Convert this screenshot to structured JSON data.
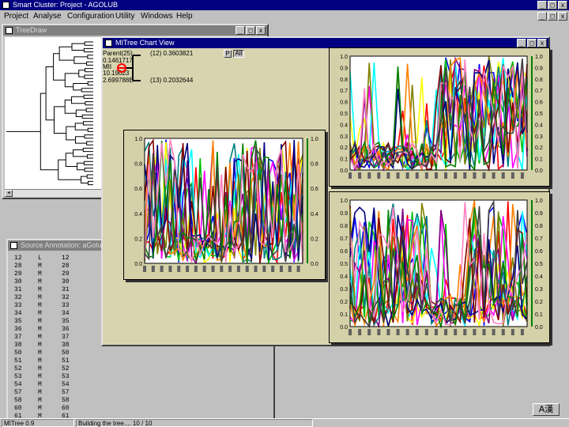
{
  "app": {
    "title": "Smart Cluster: Project - AGOLUB",
    "menu": [
      "Project",
      "Analyse",
      "Configuration",
      "Utility",
      "Windows",
      "Help"
    ],
    "window_buttons": [
      "_",
      "□",
      "x"
    ]
  },
  "treedraw": {
    "title": "TreeDraw"
  },
  "annotation": {
    "title": "Source Annotation: aGolub",
    "rows": [
      [
        "12",
        "L",
        "12"
      ],
      [
        "28",
        "M",
        "28"
      ],
      [
        "29",
        "M",
        "29"
      ],
      [
        "30",
        "M",
        "30"
      ],
      [
        "31",
        "M",
        "31"
      ],
      [
        "32",
        "M",
        "32"
      ],
      [
        "33",
        "M",
        "33"
      ],
      [
        "34",
        "M",
        "34"
      ],
      [
        "35",
        "M",
        "35"
      ],
      [
        "36",
        "M",
        "36"
      ],
      [
        "37",
        "M",
        "37"
      ],
      [
        "38",
        "M",
        "38"
      ],
      [
        "50",
        "M",
        "50"
      ],
      [
        "51",
        "M",
        "51"
      ],
      [
        "52",
        "M",
        "52"
      ],
      [
        "53",
        "M",
        "53"
      ],
      [
        "54",
        "M",
        "54"
      ],
      [
        "57",
        "M",
        "57"
      ],
      [
        "58",
        "M",
        "58"
      ],
      [
        "60",
        "M",
        "60"
      ],
      [
        "61",
        "M",
        "61"
      ]
    ]
  },
  "chartview": {
    "title": "MITree Chart View",
    "parent_label": "Parent(25)",
    "parent_value": "0.1461717",
    "mii_label": "MII",
    "mii_value": "10.19023",
    "threshold": "2.699788E",
    "child_top": "(12) 0.3603821",
    "child_bottom": "(13) 0.2032644",
    "btn_p": "P",
    "btn_all": "All",
    "yticks": [
      "1.0",
      "0.9",
      "0.8",
      "0.7",
      "0.6",
      "0.5",
      "0.4",
      "0.3",
      "0.2",
      "0.1",
      "0.0"
    ],
    "yticks_main": [
      "1.0",
      "0.8",
      "0.6",
      "0.4",
      "0.2",
      "0.0"
    ]
  },
  "status": {
    "left": "MITree 0.9",
    "right": "Building the tree.... 10 / 10"
  },
  "ime": {
    "label": "A漢"
  },
  "colors": {
    "titlebar": "#000080",
    "desktop": "#c0c0c0",
    "chart_bg": "#d4d0a8",
    "series": [
      "#ff0000",
      "#0000ff",
      "#00c000",
      "#ffff00",
      "#ff00ff",
      "#00ffff",
      "#800080",
      "#008080",
      "#808000",
      "#ff8000",
      "#800000",
      "#000080",
      "#008000",
      "#ff80c0",
      "#404040"
    ]
  },
  "chart_data": [
    {
      "type": "line",
      "panel": "main-left",
      "ylim": [
        0,
        1.0
      ],
      "yticks": [
        0.0,
        0.2,
        0.4,
        0.6,
        0.8,
        1.0
      ],
      "series_count": 15,
      "note_only_visible": "multi-series expression profiles, values estimated"
    },
    {
      "type": "line",
      "panel": "top-right",
      "ylim": [
        0,
        1.0
      ],
      "yticks": [
        0.0,
        0.1,
        0.2,
        0.3,
        0.4,
        0.5,
        0.6,
        0.7,
        0.8,
        0.9,
        1.0
      ],
      "series_count": 15
    },
    {
      "type": "line",
      "panel": "bottom-right",
      "ylim": [
        0,
        1.0
      ],
      "yticks": [
        0.0,
        0.1,
        0.2,
        0.3,
        0.4,
        0.5,
        0.6,
        0.7,
        0.8,
        0.9,
        1.0
      ],
      "series_count": 15
    }
  ]
}
